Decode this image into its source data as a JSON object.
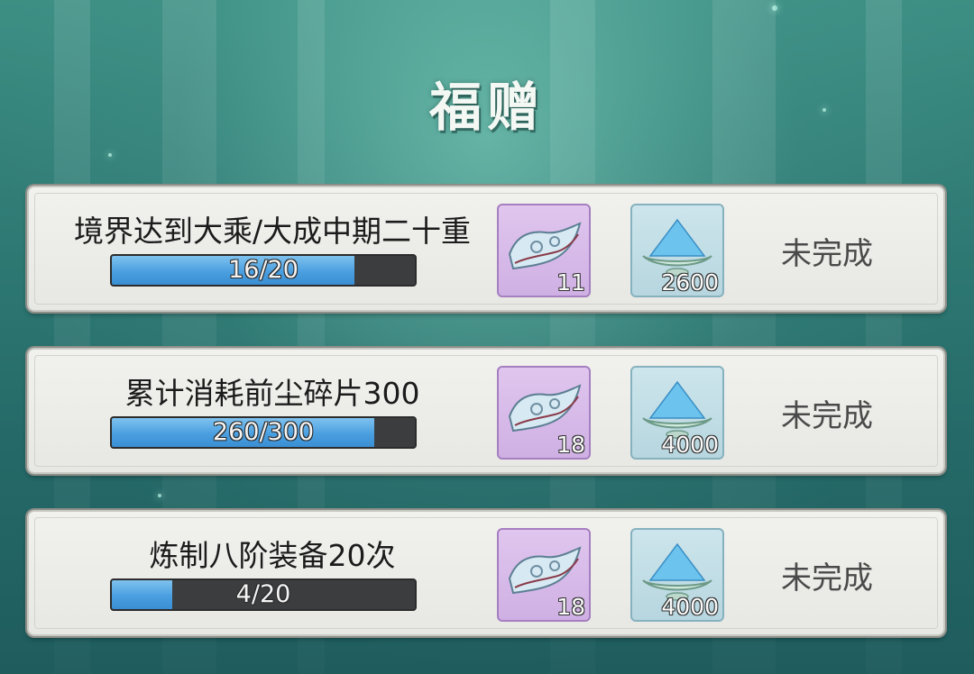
{
  "title": "福赠",
  "tasks": [
    {
      "title": "境界达到大乘/大成中期二十重",
      "progress_text": "16/20",
      "progress": 0.8,
      "reward_a": {
        "icon": "jade-scroll-icon",
        "count": "11"
      },
      "reward_b": {
        "icon": "spirit-crystal-bowl-icon",
        "count": "2600"
      },
      "status": "未完成"
    },
    {
      "title": "累计消耗前尘碎片300",
      "progress_text": "260/300",
      "progress": 0.867,
      "reward_a": {
        "icon": "jade-scroll-icon",
        "count": "18"
      },
      "reward_b": {
        "icon": "spirit-crystal-bowl-icon",
        "count": "4000"
      },
      "status": "未完成"
    },
    {
      "title": "炼制八阶装备20次",
      "progress_text": "4/20",
      "progress": 0.2,
      "reward_a": {
        "icon": "jade-scroll-icon",
        "count": "18"
      },
      "reward_b": {
        "icon": "spirit-crystal-bowl-icon",
        "count": "4000"
      },
      "status": "未完成"
    }
  ],
  "colors": {
    "progress_fill": "#4a9fe0",
    "reward_a_bg": "#d9bdec",
    "reward_b_bg": "#c3dee6"
  }
}
